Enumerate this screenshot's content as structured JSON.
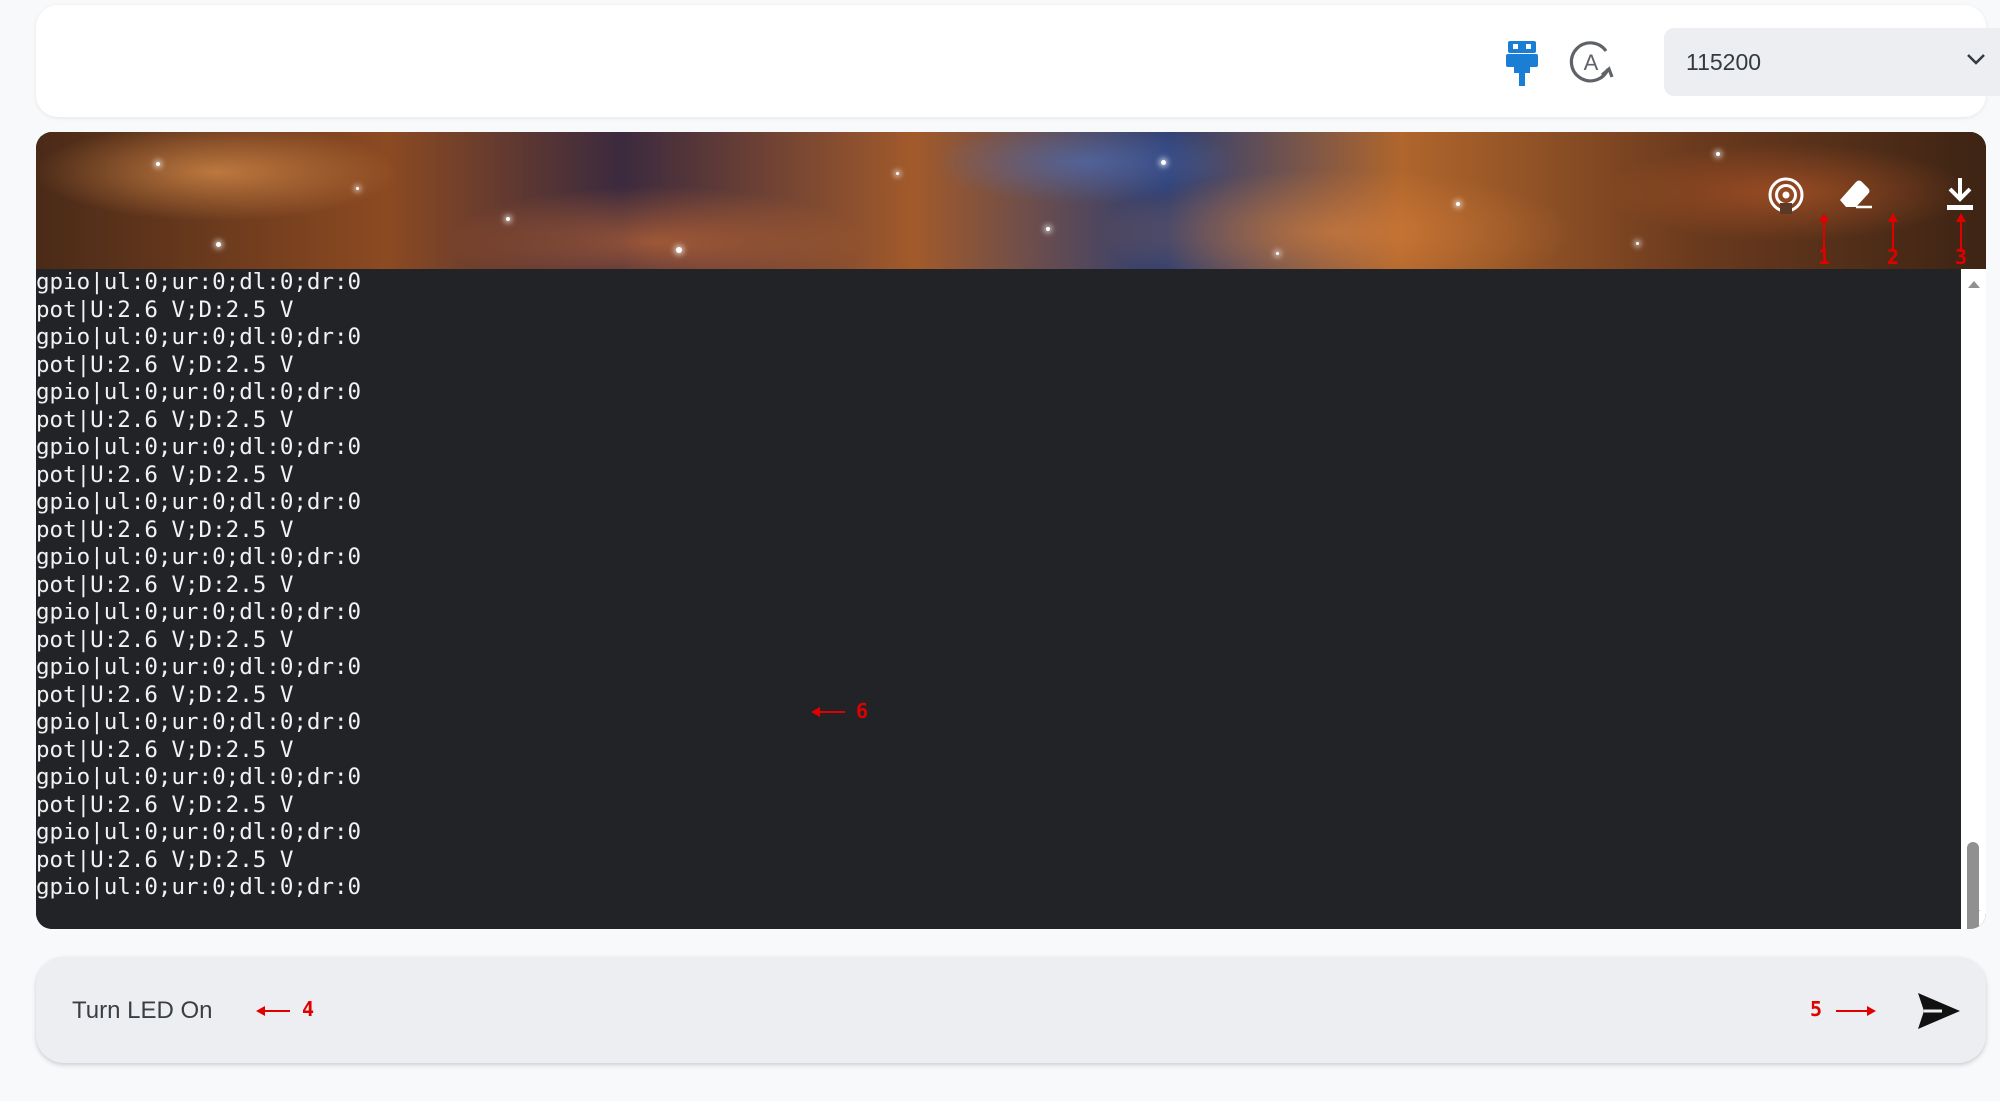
{
  "toolbar": {
    "baud_rate": "115200",
    "icons": [
      "usb-plug-icon",
      "auto-mode-icon",
      "chevron-down-icon"
    ]
  },
  "banner": {
    "icons": [
      "broadcast-icon",
      "eraser-icon",
      "download-icon"
    ],
    "markers": [
      "1",
      "2",
      "3"
    ]
  },
  "terminal": {
    "lines": [
      "gpio|ul:0;ur:0;dl:0;dr:0",
      "pot|U:2.6 V;D:2.5 V",
      "gpio|ul:0;ur:0;dl:0;dr:0",
      "pot|U:2.6 V;D:2.5 V",
      "gpio|ul:0;ur:0;dl:0;dr:0",
      "pot|U:2.6 V;D:2.5 V",
      "gpio|ul:0;ur:0;dl:0;dr:0",
      "pot|U:2.6 V;D:2.5 V",
      "gpio|ul:0;ur:0;dl:0;dr:0",
      "pot|U:2.6 V;D:2.5 V",
      "gpio|ul:0;ur:0;dl:0;dr:0",
      "pot|U:2.6 V;D:2.5 V",
      "gpio|ul:0;ur:0;dl:0;dr:0",
      "pot|U:2.6 V;D:2.5 V",
      "gpio|ul:0;ur:0;dl:0;dr:0",
      "pot|U:2.6 V;D:2.5 V",
      "gpio|ul:0;ur:0;dl:0;dr:0",
      "pot|U:2.6 V;D:2.5 V",
      "gpio|ul:0;ur:0;dl:0;dr:0",
      "pot|U:2.6 V;D:2.5 V",
      "gpio|ul:0;ur:0;dl:0;dr:0",
      "pot|U:2.6 V;D:2.5 V",
      "gpio|ul:0;ur:0;dl:0;dr:0"
    ],
    "marker": "6"
  },
  "composer": {
    "value": "Turn LED On",
    "marker_input": "4",
    "marker_send": "5",
    "send_icon": "send-icon"
  },
  "colors": {
    "accent": "#1a7fd4",
    "terminal_bg": "#212327",
    "annotation": "#e00000"
  }
}
